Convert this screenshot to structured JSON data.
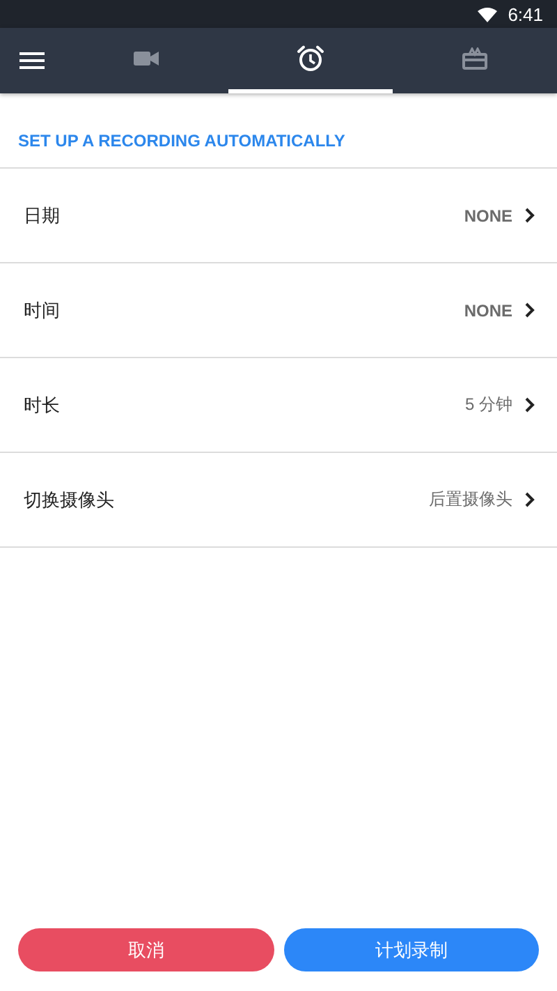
{
  "status_bar": {
    "time": "6:41"
  },
  "tabs": [
    {
      "kind": "camera",
      "selected": false
    },
    {
      "kind": "alarm",
      "selected": true
    },
    {
      "kind": "gift",
      "selected": false
    }
  ],
  "section_title": "SET UP A RECORDING AUTOMATICALLY",
  "settings": [
    {
      "label": "日期",
      "value": "NONE"
    },
    {
      "label": "时间",
      "value": "NONE"
    },
    {
      "label": "时长",
      "value": "5 分钟"
    },
    {
      "label": "切换摄像头",
      "value": "后置摄像头"
    }
  ],
  "buttons": [
    {
      "kind": "cancel",
      "label": "取消"
    },
    {
      "kind": "confirm",
      "label": "计划录制"
    }
  ]
}
